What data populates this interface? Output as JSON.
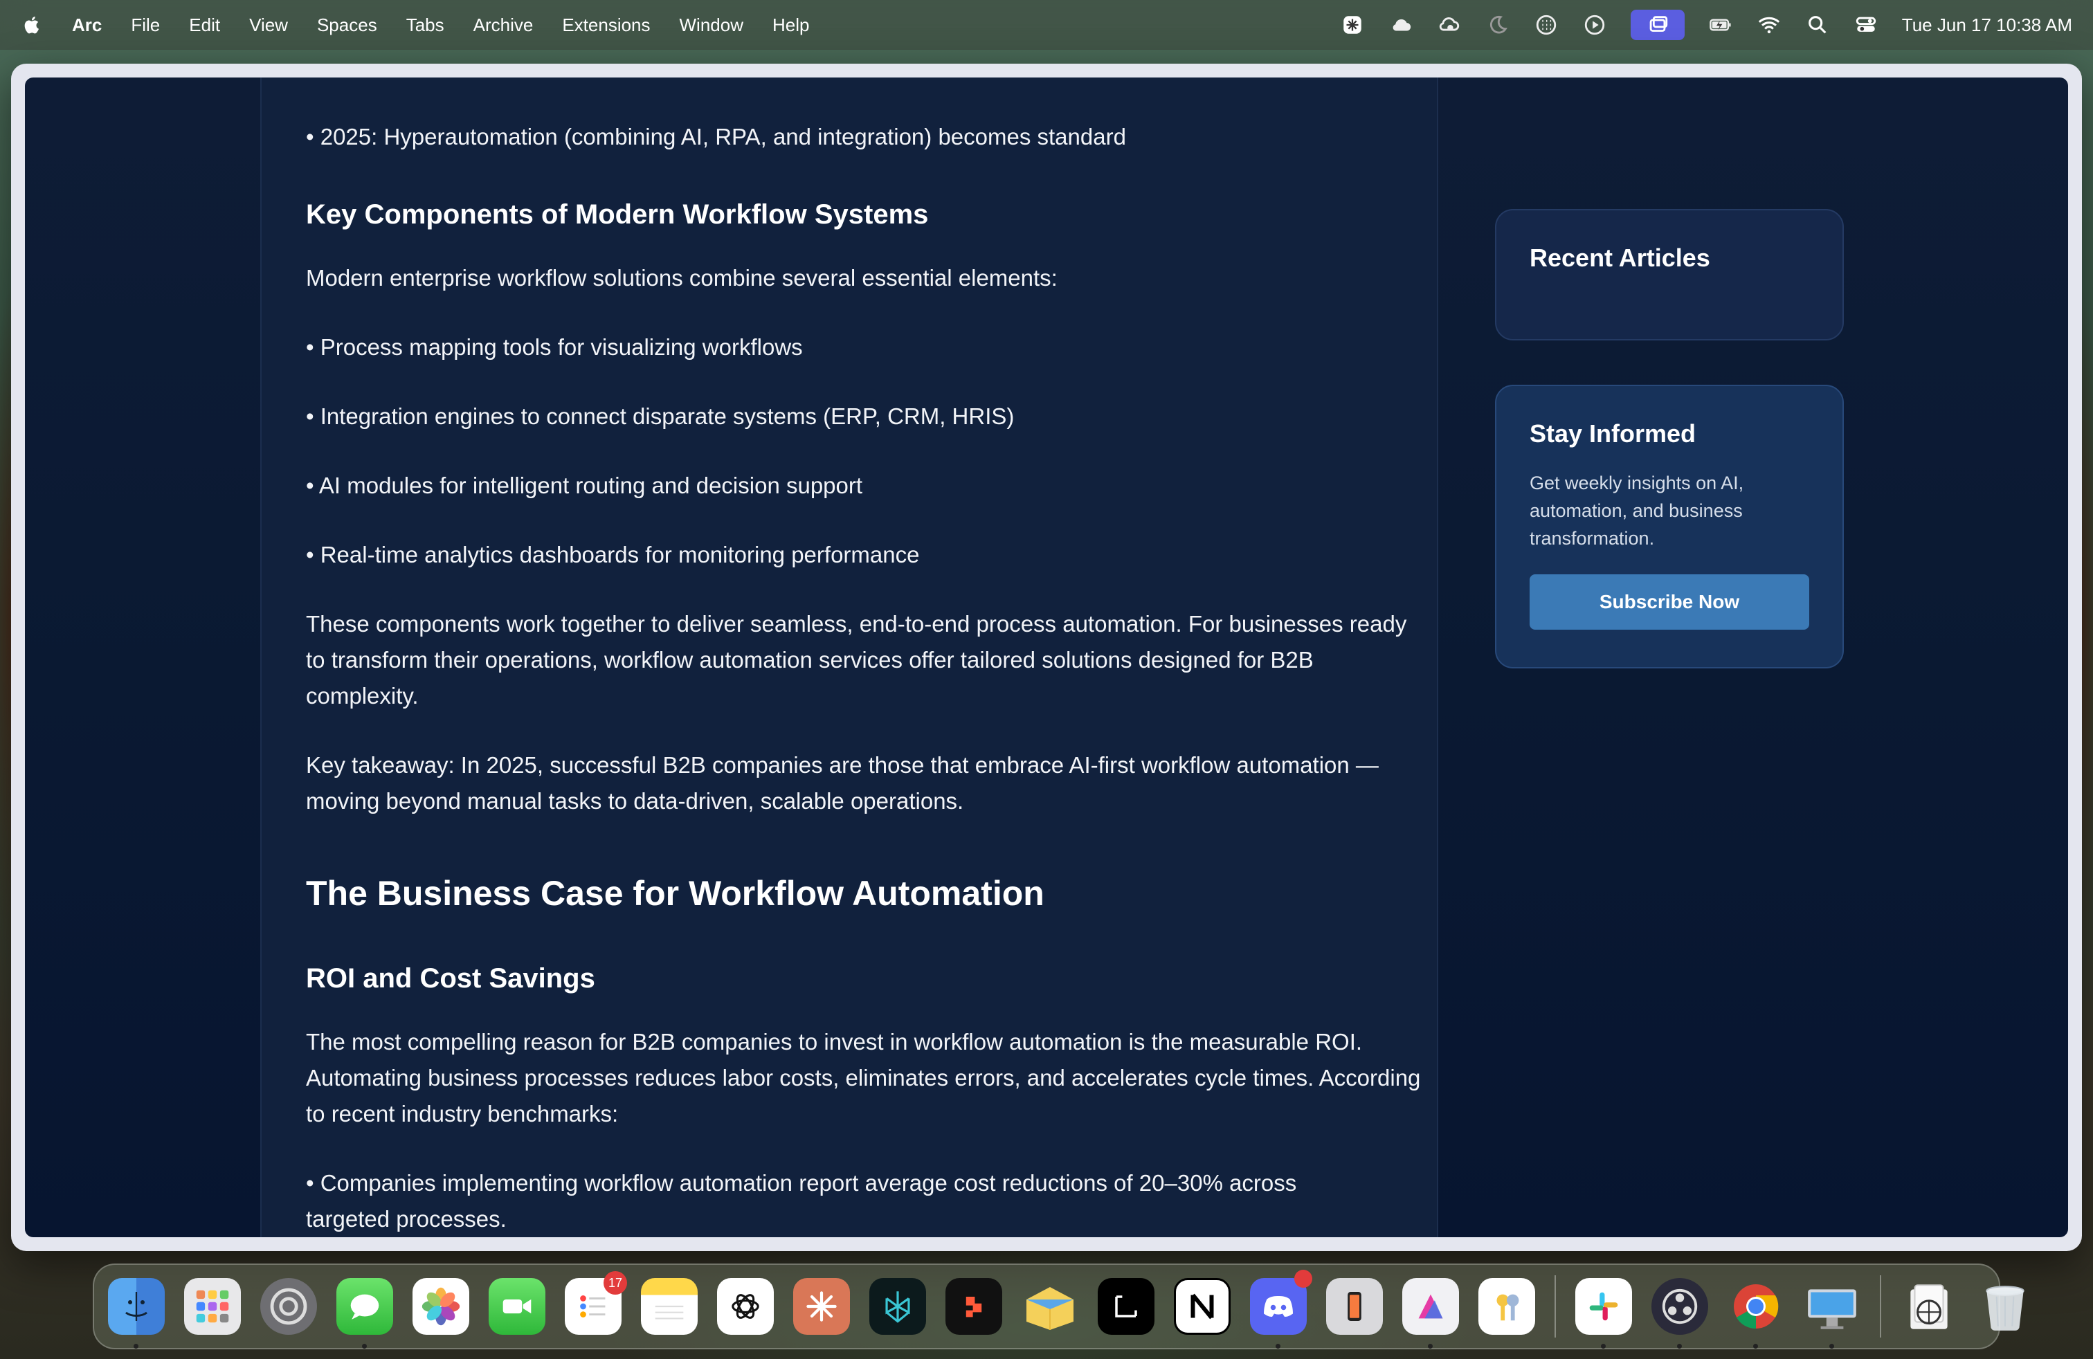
{
  "menubar": {
    "app_name": "Arc",
    "items": [
      "File",
      "Edit",
      "View",
      "Spaces",
      "Tabs",
      "Archive",
      "Extensions",
      "Window",
      "Help"
    ],
    "clock": "Tue Jun 17  10:38 AM",
    "tray_icons": [
      "perplexity-icon",
      "icloud-icon",
      "cloud-sync-icon",
      "moon-icon",
      "grid-icon",
      "play-icon",
      "screen-share-icon",
      "battery-icon",
      "wifi-icon",
      "search-icon",
      "control-center-icon"
    ]
  },
  "article": {
    "bullet_2025": "• 2025: Hyperautomation (combining AI, RPA, and integration) becomes standard",
    "h3_components": "Key Components of Modern Workflow Systems",
    "p_components_intro": "Modern enterprise workflow solutions combine several essential elements:",
    "components": [
      "• Process mapping tools for visualizing workflows",
      "• Integration engines to connect disparate systems (ERP, CRM, HRIS)",
      "• AI modules for intelligent routing and decision support",
      "• Real-time analytics dashboards for monitoring performance"
    ],
    "p_together": "These components work together to deliver seamless, end-to-end process automation. For businesses ready to transform their operations, workflow automation services offer tailored solutions designed for B2B complexity.",
    "p_takeaway": "Key takeaway: In 2025, successful B2B companies are those that embrace AI-first workflow automation —moving beyond manual tasks to data-driven, scalable operations.",
    "h2_business_case": "The Business Case for Workflow Automation",
    "h3_roi": "ROI and Cost Savings",
    "p_roi": "The most compelling reason for B2B companies to invest in workflow automation is the measurable ROI. Automating business processes reduces labor costs, eliminates errors, and accelerates cycle times. According to recent industry benchmarks:",
    "bullet_costs": "• Companies implementing workflow automation report average cost reductions of 20–30% across targeted processes."
  },
  "sidebar": {
    "recent_title": "Recent Articles",
    "stay_title": "Stay Informed",
    "stay_desc": "Get weekly insights on AI, automation, and business transformation.",
    "subscribe_label": "Subscribe Now"
  },
  "dock": {
    "reminders_badge": "17",
    "apps": [
      "finder",
      "launchpad",
      "system-settings",
      "messages",
      "photos",
      "facetime",
      "reminders",
      "notes",
      "chatgpt",
      "claude",
      "perplexity",
      "raycast",
      "airmail",
      "linear",
      "notion",
      "discord",
      "iphone-mirroring",
      "affinity",
      "keychain",
      "slack",
      "obs",
      "chrome",
      "screen-sharing",
      "preview",
      "trash"
    ]
  }
}
